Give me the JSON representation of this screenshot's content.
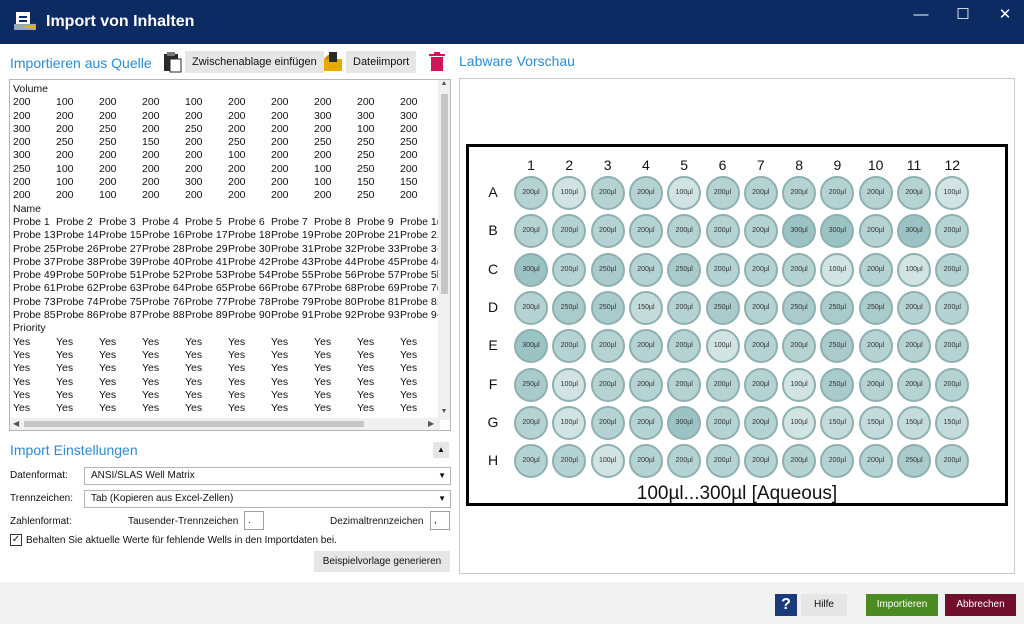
{
  "window": {
    "title": "Import von Inhalten",
    "minimize": "—",
    "maximize": "☐",
    "close": "✕"
  },
  "source": {
    "title": "Importieren aus Quelle",
    "paste_label": "Zwischenablage einfügen",
    "file_label": "Dateiimport"
  },
  "textarea": {
    "lines": [
      [
        "Volume"
      ],
      [
        "200",
        "100",
        "200",
        "200",
        "100",
        "200",
        "200",
        "200",
        "200",
        "200"
      ],
      [
        "200",
        "200",
        "200",
        "200",
        "200",
        "200",
        "200",
        "300",
        "300",
        "300"
      ],
      [
        "300",
        "200",
        "250",
        "200",
        "250",
        "200",
        "200",
        "200",
        "100",
        "200"
      ],
      [
        "200",
        "250",
        "250",
        "150",
        "200",
        "250",
        "200",
        "250",
        "250",
        "250"
      ],
      [
        "300",
        "200",
        "200",
        "200",
        "200",
        "100",
        "200",
        "200",
        "250",
        "200"
      ],
      [
        "250",
        "100",
        "200",
        "200",
        "200",
        "200",
        "200",
        "100",
        "250",
        "200"
      ],
      [
        "200",
        "100",
        "200",
        "200",
        "300",
        "200",
        "200",
        "100",
        "150",
        "150"
      ],
      [
        "200",
        "200",
        "100",
        "200",
        "200",
        "200",
        "200",
        "200",
        "250",
        "200"
      ],
      [
        "Name"
      ],
      [
        "Probe 1",
        "Probe 2",
        "Probe 3",
        "Probe 4",
        "Probe 5",
        "Probe 6",
        "Probe 7",
        "Probe 8",
        "Probe 9",
        "Probe 1("
      ],
      [
        "Probe 13",
        "Probe 14",
        "Probe 15",
        "Probe 16",
        "Probe 17",
        "Probe 18",
        "Probe 19",
        "Probe 20",
        "Probe 21",
        "Probe 2:"
      ],
      [
        "Probe 25",
        "Probe 26",
        "Probe 27",
        "Probe 28",
        "Probe 29",
        "Probe 30",
        "Probe 31",
        "Probe 32",
        "Probe 33",
        "Probe 3-"
      ],
      [
        "Probe 37",
        "Probe 38",
        "Probe 39",
        "Probe 40",
        "Probe 41",
        "Probe 42",
        "Probe 43",
        "Probe 44",
        "Probe 45",
        "Probe 4("
      ],
      [
        "Probe 49",
        "Probe 50",
        "Probe 51",
        "Probe 52",
        "Probe 53",
        "Probe 54",
        "Probe 55",
        "Probe 56",
        "Probe 57",
        "Probe 5l"
      ],
      [
        "Probe 61",
        "Probe 62",
        "Probe 63",
        "Probe 64",
        "Probe 65",
        "Probe 66",
        "Probe 67",
        "Probe 68",
        "Probe 69",
        "Probe 7("
      ],
      [
        "Probe 73",
        "Probe 74",
        "Probe 75",
        "Probe 76",
        "Probe 77",
        "Probe 78",
        "Probe 79",
        "Probe 80",
        "Probe 81",
        "Probe 8:"
      ],
      [
        "Probe 85",
        "Probe 86",
        "Probe 87",
        "Probe 88",
        "Probe 89",
        "Probe 90",
        "Probe 91",
        "Probe 92",
        "Probe 93",
        "Probe 9-"
      ],
      [
        "Priority"
      ],
      [
        "Yes",
        "Yes",
        "Yes",
        "Yes",
        "Yes",
        "Yes",
        "Yes",
        "Yes",
        "Yes",
        "Yes"
      ],
      [
        "Yes",
        "Yes",
        "Yes",
        "Yes",
        "Yes",
        "Yes",
        "Yes",
        "Yes",
        "Yes",
        "Yes"
      ],
      [
        "Yes",
        "Yes",
        "Yes",
        "Yes",
        "Yes",
        "Yes",
        "Yes",
        "Yes",
        "Yes",
        "Yes"
      ],
      [
        "Yes",
        "Yes",
        "Yes",
        "Yes",
        "Yes",
        "Yes",
        "Yes",
        "Yes",
        "Yes",
        "Yes"
      ],
      [
        "Yes",
        "Yes",
        "Yes",
        "Yes",
        "Yes",
        "Yes",
        "Yes",
        "Yes",
        "Yes",
        "Yes"
      ],
      [
        "Yes",
        "Yes",
        "Yes",
        "Yes",
        "Yes",
        "Yes",
        "Yes",
        "Yes",
        "Yes",
        "Yes"
      ]
    ]
  },
  "settings": {
    "title": "Import Einstellungen",
    "datenformat_label": "Datenformat:",
    "datenformat_value": "ANSI/SLAS Well Matrix",
    "trennzeichen_label": "Trennzeichen:",
    "trennzeichen_value": "Tab (Kopieren aus Excel-Zellen)",
    "zahlenformat_label": "Zahlenformat:",
    "tausender_label": "Tausender-Trennzeichen",
    "tausender_value": ".",
    "dezimal_label": "Dezimaltrennzeichen",
    "dezimal_value": ",",
    "keep_label": "Behalten Sie aktuelle Werte für fehlende Wells in den Importdaten bei.",
    "keep_checked": "✓",
    "generate_label": "Beispielvorlage generieren"
  },
  "preview": {
    "title": "Labware Vorschau",
    "columns": [
      "1",
      "2",
      "3",
      "4",
      "5",
      "6",
      "7",
      "8",
      "9",
      "10",
      "11",
      "12"
    ],
    "rows": [
      "A",
      "B",
      "C",
      "D",
      "E",
      "F",
      "G",
      "H"
    ],
    "wells": [
      [
        "200µl",
        "100µl",
        "200µl",
        "200µl",
        "100µl",
        "200µl",
        "200µl",
        "200µl",
        "200µl",
        "200µl",
        "200µl",
        "100µl"
      ],
      [
        "200µl",
        "200µl",
        "200µl",
        "200µl",
        "200µl",
        "200µl",
        "200µl",
        "300µl",
        "300µl",
        "200µl",
        "300µl",
        "200µl"
      ],
      [
        "300µl",
        "200µl",
        "250µl",
        "200µl",
        "250µl",
        "200µl",
        "200µl",
        "200µl",
        "100µl",
        "200µl",
        "100µl",
        "200µl"
      ],
      [
        "200µl",
        "250µl",
        "250µl",
        "150µl",
        "200µl",
        "250µl",
        "200µl",
        "250µl",
        "250µl",
        "250µl",
        "200µl",
        "200µl"
      ],
      [
        "300µl",
        "200µl",
        "200µl",
        "200µl",
        "200µl",
        "100µl",
        "200µl",
        "200µl",
        "250µl",
        "200µl",
        "200µl",
        "200µl"
      ],
      [
        "250µl",
        "100µl",
        "200µl",
        "200µl",
        "200µl",
        "200µl",
        "200µl",
        "100µl",
        "250µl",
        "200µl",
        "200µl",
        "200µl"
      ],
      [
        "200µl",
        "100µl",
        "200µl",
        "200µl",
        "300µl",
        "200µl",
        "200µl",
        "100µl",
        "150µl",
        "150µl",
        "150µl",
        "150µl"
      ],
      [
        "200µl",
        "200µl",
        "100µl",
        "200µl",
        "200µl",
        "200µl",
        "200µl",
        "200µl",
        "200µl",
        "200µl",
        "250µl",
        "200µl"
      ]
    ],
    "footer": "100µl...300µl [Aqueous]"
  },
  "buttons": {
    "help_icon": "?",
    "help": "Hilfe",
    "import": "Importieren",
    "cancel": "Abbrechen"
  },
  "colors": {
    "titlebar": "#0c2b63",
    "accent": "#2d8bcf",
    "import": "#4c8a22",
    "cancel": "#6f0f2c"
  }
}
